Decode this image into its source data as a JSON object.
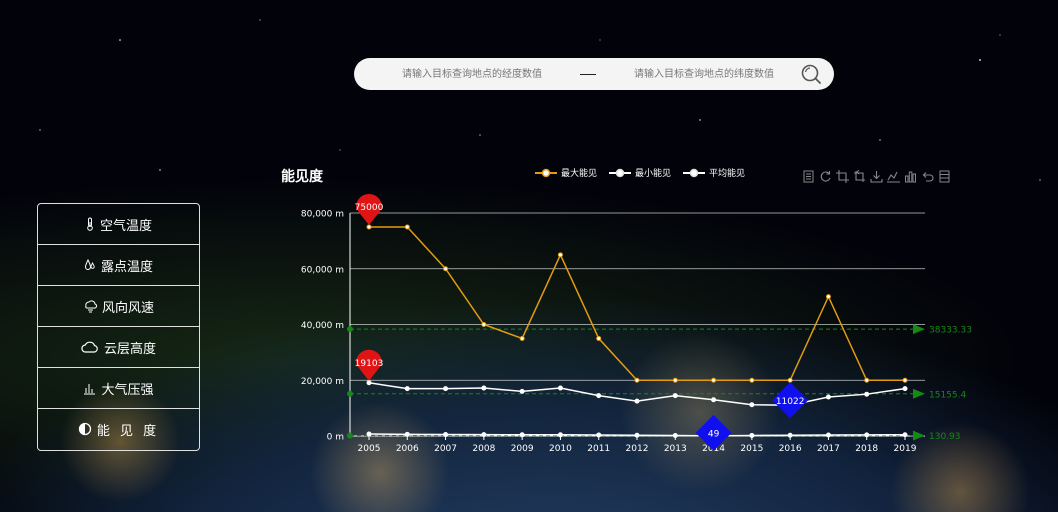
{
  "search": {
    "lng_placeholder": "请输入目标查询地点的经度数值",
    "lat_placeholder": "请输入目标查询地点的纬度数值"
  },
  "menu": [
    {
      "label": "空气温度",
      "icon": "thermometer-icon"
    },
    {
      "label": "露点温度",
      "icon": "dewpoint-icon"
    },
    {
      "label": "风向风速",
      "icon": "wind-icon"
    },
    {
      "label": "云层高度",
      "icon": "cloud-icon"
    },
    {
      "label": "大气压强",
      "icon": "pressure-chart-icon"
    },
    {
      "label": "能 见 度",
      "icon": "contrast-icon"
    }
  ],
  "toolbox": [
    "data-view-icon",
    "refresh-icon",
    "crop-icon",
    "crop-back-icon",
    "download-icon",
    "line-chart-icon",
    "bar-chart-icon",
    "undo-icon",
    "stack-icon"
  ],
  "colors": {
    "max": "#e39c0f",
    "min": "#ffffff",
    "avg": "#ffffff",
    "markpoint_max": "#e01414",
    "markpoint_min": "#1010ee",
    "markline": "#138a13",
    "grid": "#e8e8e8"
  },
  "chart_data": {
    "type": "line",
    "title": "能见度",
    "categories": [
      "2005",
      "2006",
      "2007",
      "2008",
      "2009",
      "2010",
      "2011",
      "2012",
      "2013",
      "2014",
      "2015",
      "2016",
      "2017",
      "2018",
      "2019"
    ],
    "y_ticks": [
      "0 m",
      "20,000 m",
      "40,000 m",
      "60,000 m",
      "80,000 m"
    ],
    "ylim": [
      0,
      80000
    ],
    "series": [
      {
        "name": "最大能见",
        "values": [
          75000,
          75000,
          60000,
          40000,
          35000,
          65000,
          35000,
          20000,
          20000,
          20000,
          20000,
          20000,
          50000,
          20000,
          20000
        ]
      },
      {
        "name": "最小能见",
        "values": [
          19103,
          17000,
          17000,
          17200,
          16000,
          17200,
          14500,
          12500,
          14500,
          13000,
          11200,
          11022,
          14000,
          15000,
          17000
        ]
      },
      {
        "name": "平均能见",
        "values": [
          700,
          600,
          520,
          480,
          430,
          430,
          380,
          260,
          170,
          49,
          200,
          260,
          350,
          400,
          450
        ]
      }
    ],
    "mark_points": [
      {
        "series": 0,
        "label": "75000",
        "index": 0,
        "value": 75000
      },
      {
        "series": 1,
        "label": "19103",
        "index": 0,
        "value": 19103
      },
      {
        "series": 1,
        "label": "11022",
        "index": 11,
        "value": 11022
      },
      {
        "series": 2,
        "label": "49",
        "index": 9,
        "value": 49
      }
    ],
    "mark_lines": [
      {
        "label": "38333.33",
        "value": 38333.33
      },
      {
        "label": "15155.4",
        "value": 15155.4
      },
      {
        "label": "130.93",
        "value": 130.93
      }
    ],
    "grid": true,
    "legend": "top-center"
  }
}
